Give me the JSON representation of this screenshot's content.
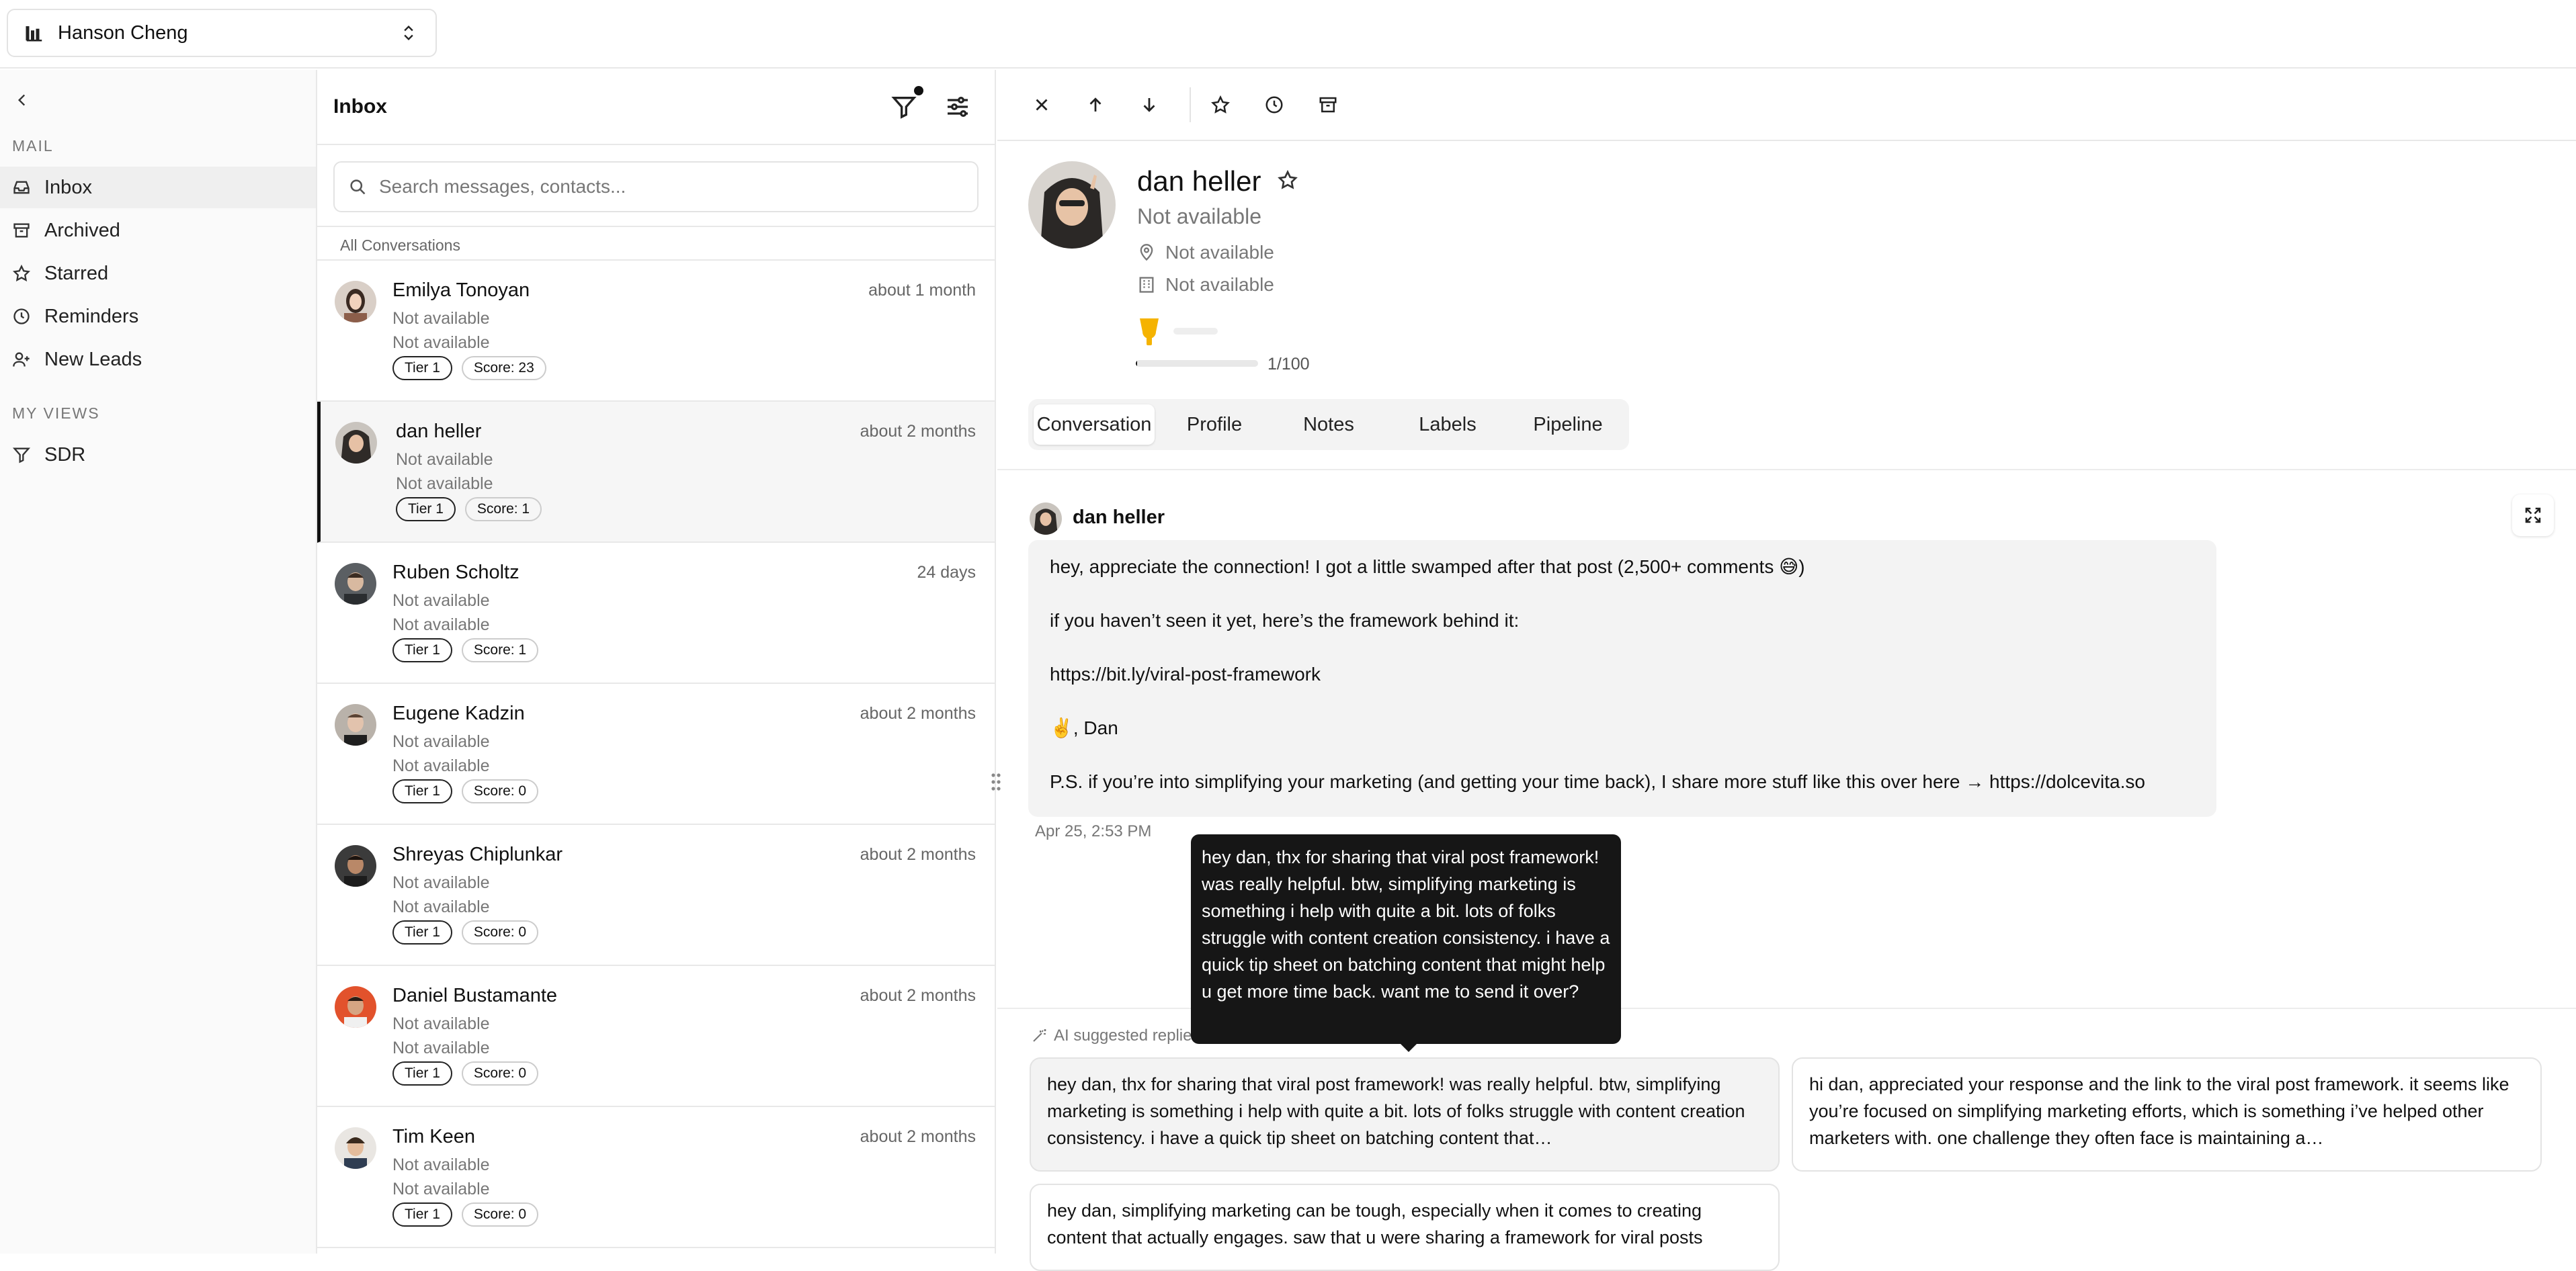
{
  "account": {
    "name": "Hanson Cheng",
    "icon": "org-chart-icon"
  },
  "sidebar": {
    "sections": [
      {
        "label": "MAIL"
      },
      {
        "label": "MY VIEWS"
      }
    ],
    "items": [
      {
        "label": "Inbox",
        "icon": "inbox-icon"
      },
      {
        "label": "Archived",
        "icon": "archive-icon"
      },
      {
        "label": "Starred",
        "icon": "star-icon"
      },
      {
        "label": "Reminders",
        "icon": "clock-icon"
      },
      {
        "label": "New Leads",
        "icon": "user-plus-icon"
      },
      {
        "label": "SDR",
        "icon": "filter-icon"
      }
    ]
  },
  "inbox": {
    "title": "Inbox",
    "search_placeholder": "Search messages, contacts...",
    "section_label": "All Conversations",
    "conversations": [
      {
        "name": "Emilya Tonoyan",
        "time": "about 1 month",
        "line1": "Not available",
        "line2": "Not available",
        "tier": "Tier 1",
        "score": "Score: 23"
      },
      {
        "name": "dan heller",
        "time": "about 2 months",
        "line1": "Not available",
        "line2": "Not available",
        "tier": "Tier 1",
        "score": "Score: 1"
      },
      {
        "name": "Ruben Scholtz",
        "time": "24 days",
        "line1": "Not available",
        "line2": "Not available",
        "tier": "Tier 1",
        "score": "Score: 1"
      },
      {
        "name": "Eugene Kadzin",
        "time": "about 2 months",
        "line1": "Not available",
        "line2": "Not available",
        "tier": "Tier 1",
        "score": "Score: 0"
      },
      {
        "name": "Shreyas Chiplunkar",
        "time": "about 2 months",
        "line1": "Not available",
        "line2": "Not available",
        "tier": "Tier 1",
        "score": "Score: 0"
      },
      {
        "name": "Daniel Bustamante",
        "time": "about 2 months",
        "line1": "Not available",
        "line2": "Not available",
        "tier": "Tier 1",
        "score": "Score: 0"
      },
      {
        "name": "Tim Keen",
        "time": "about 2 months",
        "line1": "Not available",
        "line2": "Not available",
        "tier": "Tier 1",
        "score": "Score: 0"
      }
    ]
  },
  "contact": {
    "name": "dan heller",
    "title": "Not available",
    "location": "Not available",
    "company": "Not available",
    "score": "1/100",
    "score_fraction": 0.01,
    "tabs": [
      "Conversation",
      "Profile",
      "Notes",
      "Labels",
      "Pipeline"
    ]
  },
  "message": {
    "sender": "dan heller",
    "lines": [
      "hey, appreciate the connection! I got a little swamped after that post (2,500+ comments 😅)",
      "if you haven’t seen it yet, here’s the framework behind it:",
      "https://bit.ly/viral-post-framework",
      "✌️, Dan",
      "P.S. if you’re into simplifying your marketing (and getting your time back), I share more stuff like this over here → https://dolcevita.so"
    ],
    "timestamp": "Apr 25, 2:53 PM"
  },
  "ai": {
    "label": "AI suggested replies",
    "suggestions": [
      "hey dan, thx for sharing that viral post framework! was really helpful. btw, simplifying marketing is something i help with quite a bit. lots of folks struggle with content creation consistency. i have a quick tip sheet on batching content that…",
      "hi dan, appreciated your response and the link to the viral post framework. it seems like you’re focused on simplifying marketing efforts, which is something i’ve helped other marketers with. one challenge they often face is maintaining a…",
      "hey dan, simplifying marketing can be tough, especially when it comes to creating content that actually engages. saw that u were sharing a framework for viral posts"
    ],
    "tooltip": "hey dan, thx for sharing that viral post framework! was really helpful. btw, simplifying marketing is something i help with quite a bit. lots of folks struggle with content creation consistency. i have a quick tip sheet on batching content that might help u get more time back. want me to send it over?"
  },
  "colors": {
    "accent": "#111111",
    "tier_gold": "#f5b301",
    "muted": "#777777"
  }
}
